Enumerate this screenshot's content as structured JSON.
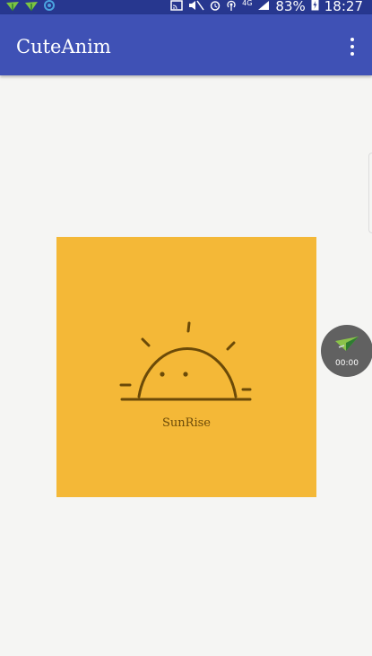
{
  "status_bar": {
    "network_type": "4G",
    "battery_percent": "83%",
    "time": "18:27",
    "icons": [
      "notification-icon",
      "notification-icon",
      "sync-icon",
      "cast-icon",
      "mute-icon",
      "alarm-icon",
      "hotspot-icon",
      "signal-icon",
      "battery-charging-icon"
    ]
  },
  "app_bar": {
    "title": "CuteAnim",
    "menu_icon": "more-vert-icon"
  },
  "card": {
    "caption": "SunRise",
    "background_color": "#f4b837",
    "line_color": "#6b4a08"
  },
  "floating_widget": {
    "time": "00:00",
    "icon": "paper-plane-icon"
  },
  "colors": {
    "status_bar": "#27378f",
    "app_bar": "#3f51b5",
    "page_background": "#f5f5f3",
    "widget_background": "#616161"
  }
}
